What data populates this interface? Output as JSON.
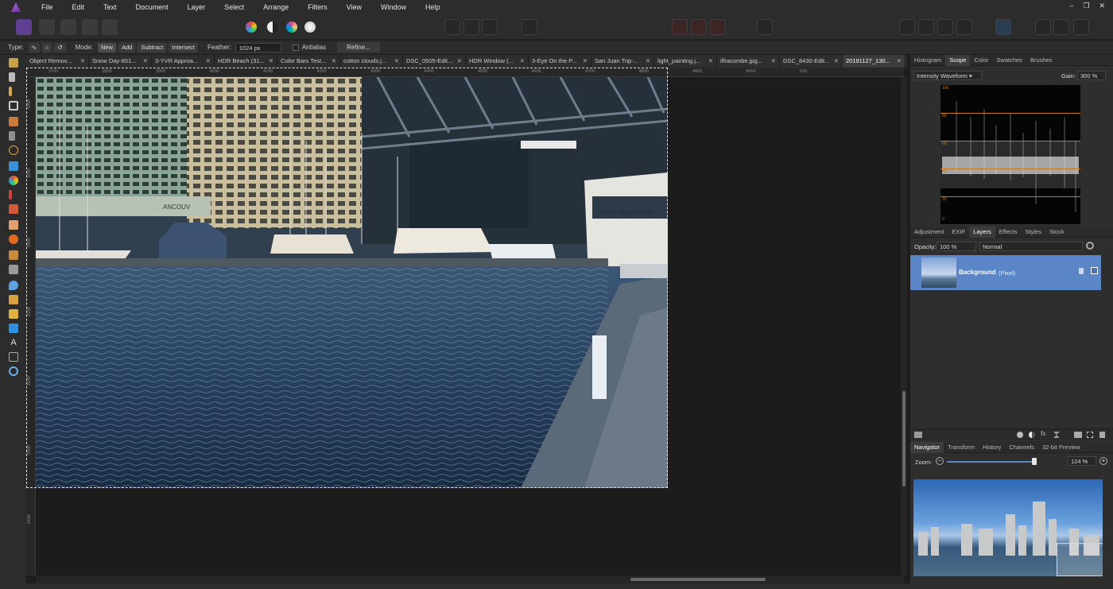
{
  "menubar": {
    "items": [
      "File",
      "Edit",
      "Text",
      "Document",
      "Layer",
      "Select",
      "Arrange",
      "Filters",
      "View",
      "Window",
      "Help"
    ],
    "controls": [
      "–",
      "❐",
      "✕"
    ]
  },
  "context_bar": {
    "type_label": "Type:",
    "mode_label": "Mode:",
    "modes": [
      "New",
      "Add",
      "Subtract",
      "Intersect"
    ],
    "selected_mode": "New",
    "feather_label": "Feather:",
    "feather_value": "1024 px",
    "antialias_label": "Antialias",
    "refine_label": "Refine..."
  },
  "document_tabs": [
    {
      "label": "Object Remov...",
      "active": false
    },
    {
      "label": "Snow Day-851...",
      "active": false
    },
    {
      "label": "3-YVR Approa...",
      "active": false
    },
    {
      "label": "HDR Beach (31...",
      "active": false
    },
    {
      "label": "Color Bars Test...",
      "active": false
    },
    {
      "label": "cotton clouds.j...",
      "active": false
    },
    {
      "label": "DSC_0505-Edit...",
      "active": false
    },
    {
      "label": "HDR Window (...",
      "active": false
    },
    {
      "label": "3-Eye On the P...",
      "active": false
    },
    {
      "label": "San Juan Trip-...",
      "active": false
    },
    {
      "label": "light_painting.j...",
      "active": false
    },
    {
      "label": "ilfracombe.jpg...",
      "active": false
    },
    {
      "label": "DSC_8430-Edit...",
      "active": false
    },
    {
      "label": "20191127_130...",
      "active": true
    }
  ],
  "ruler": {
    "h_ticks": [
      "3700",
      "3800",
      "3900",
      "4000",
      "4100",
      "4200",
      "4300",
      "4400",
      "4500",
      "4600",
      "4700",
      "4800",
      "4900",
      "5000",
      "510"
    ],
    "v_ticks": [
      "1800",
      "1900",
      "2000",
      "2100",
      "2200",
      "2300",
      "2400"
    ]
  },
  "photo_text": {
    "sign": "ANCOUV",
    "boat_name": "ROYAL VANCOUVER"
  },
  "scope_panel": {
    "tabs": [
      "Histogram",
      "Scope",
      "Color",
      "Swatches",
      "Brushes"
    ],
    "active_tab": "Scope",
    "scope_type": "Intensity Waveform",
    "gain_label": "Gain:",
    "gain_value": "300 %",
    "levels": [
      "100",
      "80",
      "60",
      "40",
      "20",
      "0"
    ]
  },
  "layers_panel": {
    "tabs": [
      "Adjustment",
      "EXIF",
      "Layers",
      "Effects",
      "Styles",
      "Stock"
    ],
    "active_tab": "Layers",
    "opacity_label": "Opacity:",
    "opacity_value": "100 %",
    "blend_mode": "Normal",
    "layer_name": "Background",
    "layer_type": "(Pixel)"
  },
  "navigator_panel": {
    "tabs": [
      "Navigator",
      "Transform",
      "History",
      "Channels",
      "32-bit Preview"
    ],
    "active_tab": "Navigator",
    "zoom_label": "Zoom:",
    "zoom_value": "124 %",
    "zoom_level": 0.86
  }
}
